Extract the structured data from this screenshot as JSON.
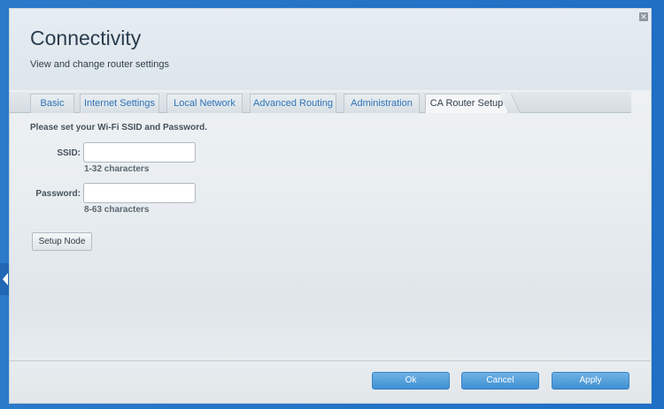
{
  "dialog": {
    "title": "Connectivity",
    "subtitle": "View and change router settings",
    "close_icon": "close-icon"
  },
  "tabs": [
    {
      "label": "Basic"
    },
    {
      "label": "Internet Settings"
    },
    {
      "label": "Local Network"
    },
    {
      "label": "Advanced Routing"
    },
    {
      "label": "Administration"
    },
    {
      "label": "CA Router Setup",
      "active": true
    }
  ],
  "form": {
    "instruction": "Please set your Wi-Fi SSID and Password.",
    "ssid_label": "SSID:",
    "ssid_value": "",
    "ssid_hint": "1-32 characters",
    "password_label": "Password:",
    "password_value": "",
    "password_hint": "8-63 characters",
    "setup_button": "Setup Node"
  },
  "footer": {
    "ok": "Ok",
    "cancel": "Cancel",
    "apply": "Apply"
  },
  "colors": {
    "accent": "#3f8fd2",
    "tab_text": "#2e73b7",
    "background": "#1f72c8"
  }
}
